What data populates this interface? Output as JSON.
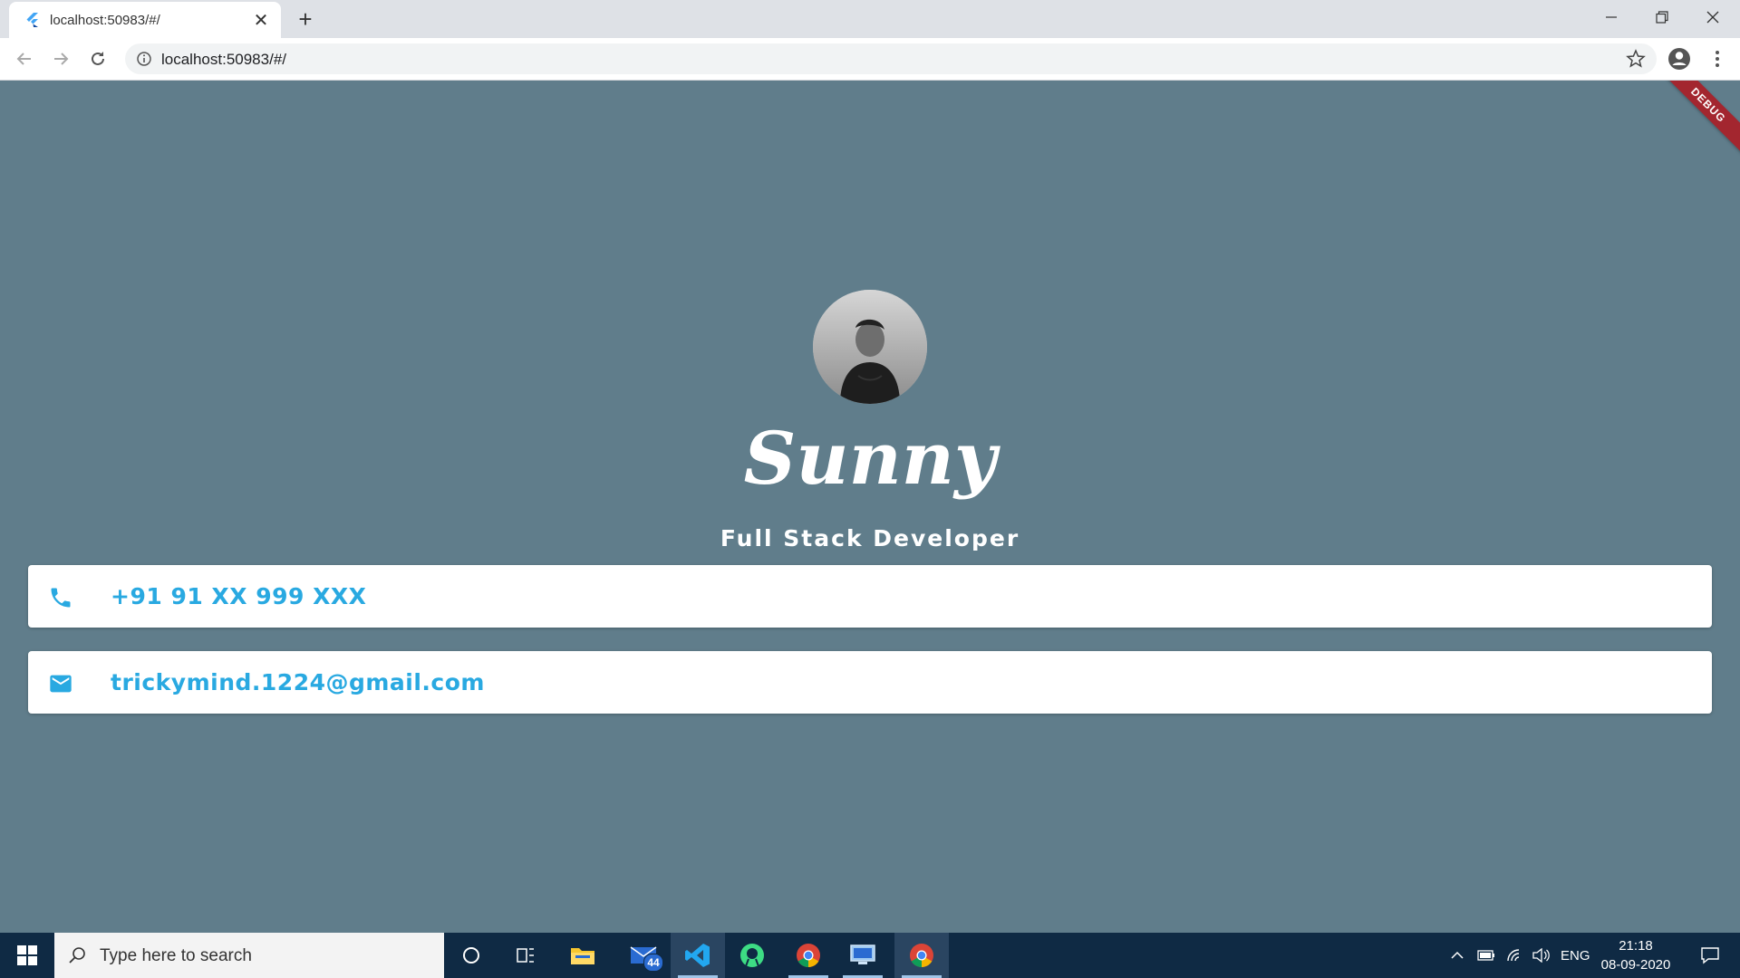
{
  "browser": {
    "tab_title": "localhost:50983/#/",
    "url": "localhost:50983/#/"
  },
  "app": {
    "debug_banner": "DEBUG",
    "name": "Sunny",
    "subtitle": "Full Stack Developer",
    "phone": "+91 91 XX 999 XXX",
    "email": "trickymind.1224@gmail.com",
    "background_color": "#607d8b",
    "accent_color": "#29a9e1"
  },
  "taskbar": {
    "search_placeholder": "Type here to search",
    "mail_badge": "44",
    "language": "ENG",
    "time": "21:18",
    "date": "08-09-2020"
  },
  "icons": [
    "flutter-icon",
    "close-icon",
    "plus-icon",
    "minimize-icon",
    "restore-icon",
    "back-arrow-icon",
    "forward-arrow-icon",
    "reload-icon",
    "info-icon",
    "star-icon",
    "account-icon",
    "more-vert-icon",
    "phone-icon",
    "mail-icon",
    "windows-start-icon",
    "search-icon",
    "cortana-icon",
    "task-view-icon",
    "file-explorer-icon",
    "mail-app-icon",
    "vscode-icon",
    "android-studio-icon",
    "chrome-icon",
    "remote-desktop-icon",
    "chevron-up-icon",
    "battery-icon",
    "wifi-icon",
    "volume-icon",
    "notification-icon"
  ]
}
